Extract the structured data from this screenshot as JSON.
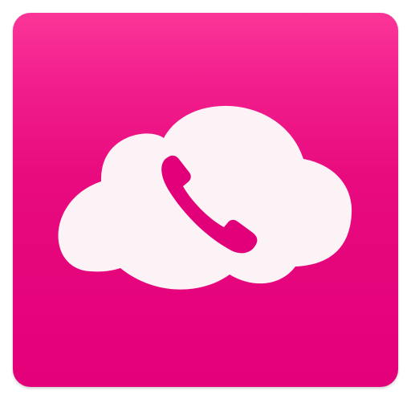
{
  "app_icon": {
    "name": "cloud-phone-app-icon",
    "icon": "cloud-phone-icon",
    "colors": {
      "background_top": "#fb3597",
      "background_bottom": "#e3007a",
      "cloud": "#fcf3f6",
      "handset": "#e2007a"
    }
  }
}
